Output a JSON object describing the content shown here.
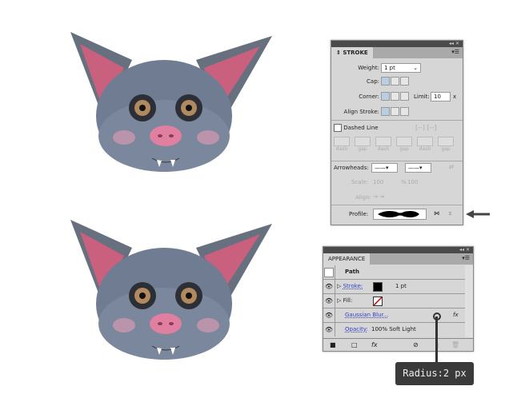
{
  "stroke_panel": {
    "title": "STROKE",
    "weight_label": "Weight:",
    "weight_value": "1 pt",
    "cap_label": "Cap:",
    "corner_label": "Corner:",
    "limit_label": "Limit:",
    "limit_value": "10",
    "limit_unit": "x",
    "align_label": "Align Stroke:",
    "dashed_label": "Dashed Line",
    "dash_labels": [
      "dash",
      "gap",
      "dash",
      "gap",
      "dash",
      "gap"
    ],
    "arrowheads_label": "Arrowheads:",
    "scale_label": "Scale:",
    "scale_1": "100",
    "scale_2": "100",
    "percent": "%",
    "align_arrow_label": "Align:",
    "profile_label": "Profile:"
  },
  "appearance_panel": {
    "title": "APPEARANCE",
    "path_label": "Path",
    "stroke_label": "Stroke:",
    "stroke_value": "1 pt",
    "fill_label": "Fill:",
    "effect_label": "Gaussian Blur...",
    "opacity_label": "Opacity:",
    "opacity_value": "100% Soft Light",
    "fx": "fx"
  },
  "tooltip": {
    "text": "Radius:2 px"
  },
  "colors": {
    "panel": "#d6d6d6",
    "bat_body": "#6d7a8f",
    "ear_inner": "#c9607e",
    "nose": "#e07fa0",
    "tooltip": "#3a3a3a"
  }
}
